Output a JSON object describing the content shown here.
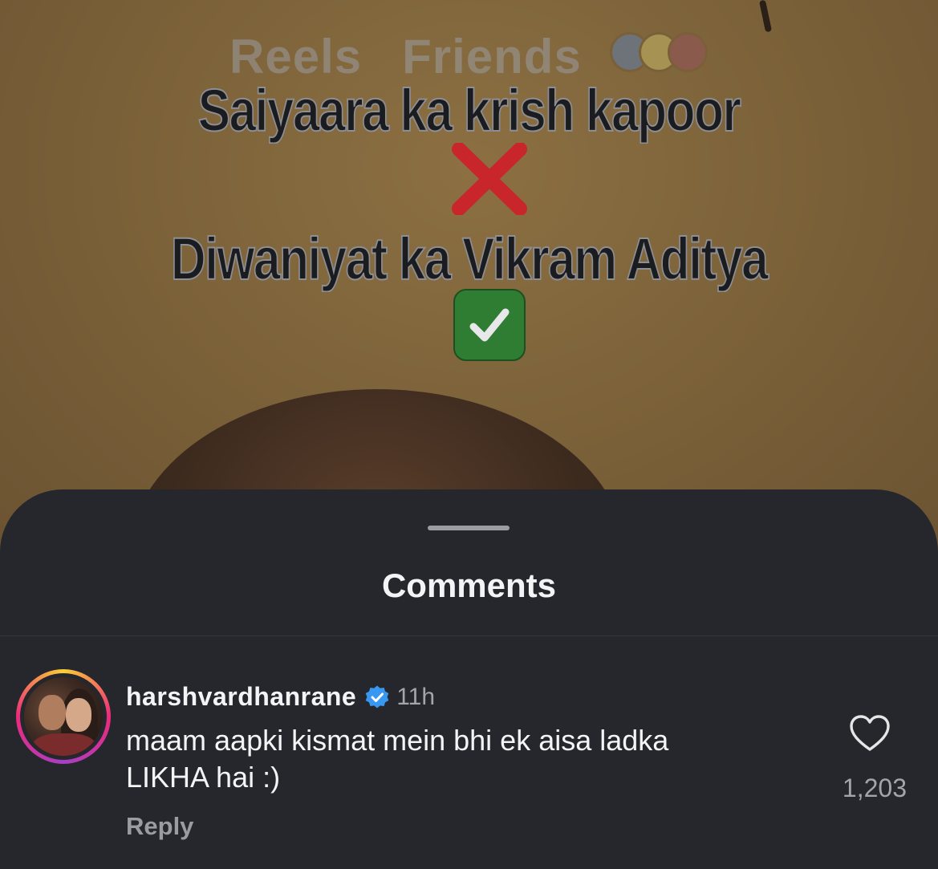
{
  "top_nav": {
    "tabs": [
      "Reels",
      "Friends"
    ]
  },
  "reel_overlay": {
    "line1": "Saiyaara ka krish kapoor",
    "line2": "Diwaniyat ka Vikram Aditya",
    "cross_icon": "cross-mark-icon",
    "check_icon": "check-mark-icon"
  },
  "sheet": {
    "title": "Comments"
  },
  "comment": {
    "username": "harshvardhanrane",
    "time": "11h",
    "text_line1": "maam aapki kismat mein bhi ek aisa ladka",
    "text_line2": "LIKHA hai :)",
    "reply_label": "Reply",
    "like_count": "1,203"
  },
  "colors": {
    "sheet_bg": "#25272c",
    "verified": "#3897f0",
    "story_ring": [
      "#f9ce34",
      "#ee2a7b",
      "#a53fc4"
    ]
  }
}
